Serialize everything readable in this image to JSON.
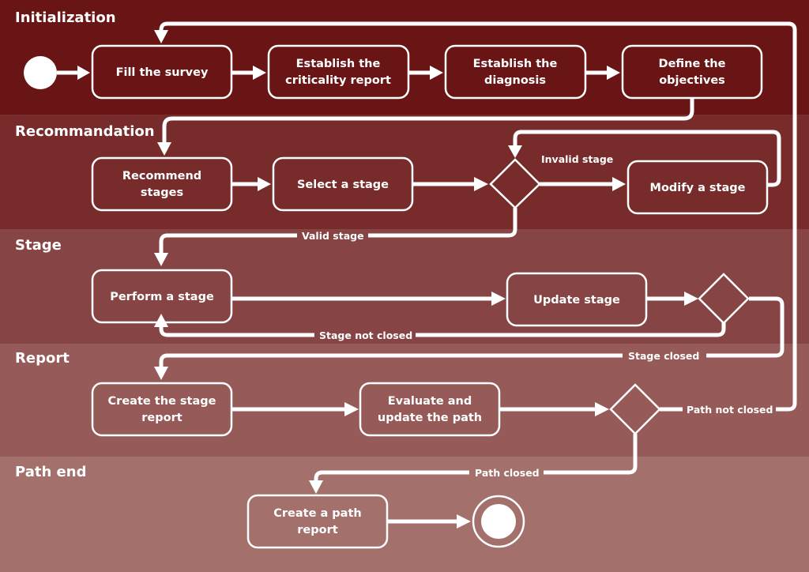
{
  "diagram": {
    "type": "uml-activity-swimlane",
    "lanes": [
      {
        "id": "initialization",
        "label": "Initialization",
        "color": "#6a1515"
      },
      {
        "id": "recommandation",
        "label": "Recommandation",
        "color": "#772b2a"
      },
      {
        "id": "stage",
        "label": "Stage",
        "color": "#864444"
      },
      {
        "id": "report",
        "label": "Report",
        "color": "#965a58"
      },
      {
        "id": "path_end",
        "label": "Path end",
        "color": "#a3706c"
      }
    ],
    "nodes": {
      "start": {
        "kind": "initial"
      },
      "fill_survey": {
        "kind": "action",
        "lines": [
          "Fill the survey"
        ]
      },
      "criticality_report": {
        "kind": "action",
        "lines": [
          "Establish the",
          "criticality report"
        ]
      },
      "diagnosis": {
        "kind": "action",
        "lines": [
          "Establish the",
          "diagnosis"
        ]
      },
      "objectives": {
        "kind": "action",
        "lines": [
          "Define the",
          "objectives"
        ]
      },
      "recommend_stages": {
        "kind": "action",
        "lines": [
          "Recommend",
          "stages"
        ]
      },
      "select_stage": {
        "kind": "action",
        "lines": [
          "Select a stage"
        ]
      },
      "stage_decision": {
        "kind": "decision"
      },
      "modify_stage": {
        "kind": "action",
        "lines": [
          "Modify a stage"
        ]
      },
      "perform_stage": {
        "kind": "action",
        "lines": [
          "Perform a stage"
        ]
      },
      "update_stage": {
        "kind": "action",
        "lines": [
          "Update stage"
        ]
      },
      "closed_decision": {
        "kind": "decision"
      },
      "stage_report": {
        "kind": "action",
        "lines": [
          "Create the stage",
          "report"
        ]
      },
      "evaluate_path": {
        "kind": "action",
        "lines": [
          "Evaluate and",
          "update the path"
        ]
      },
      "path_decision": {
        "kind": "decision"
      },
      "path_report": {
        "kind": "action",
        "lines": [
          "Create a path",
          "report"
        ]
      },
      "end": {
        "kind": "final"
      }
    },
    "edges": [
      {
        "from": "start",
        "to": "fill_survey",
        "label": ""
      },
      {
        "from": "fill_survey",
        "to": "criticality_report",
        "label": ""
      },
      {
        "from": "criticality_report",
        "to": "diagnosis",
        "label": ""
      },
      {
        "from": "diagnosis",
        "to": "objectives",
        "label": ""
      },
      {
        "from": "objectives",
        "to": "recommend_stages",
        "label": ""
      },
      {
        "from": "recommend_stages",
        "to": "select_stage",
        "label": ""
      },
      {
        "from": "select_stage",
        "to": "stage_decision",
        "label": ""
      },
      {
        "from": "stage_decision",
        "to": "modify_stage",
        "label": "Invalid stage"
      },
      {
        "from": "modify_stage",
        "to": "stage_decision",
        "label": ""
      },
      {
        "from": "stage_decision",
        "to": "perform_stage",
        "label": "Valid stage"
      },
      {
        "from": "perform_stage",
        "to": "update_stage",
        "label": ""
      },
      {
        "from": "update_stage",
        "to": "closed_decision",
        "label": ""
      },
      {
        "from": "closed_decision",
        "to": "perform_stage",
        "label": "Stage not closed"
      },
      {
        "from": "closed_decision",
        "to": "stage_report",
        "label": "Stage closed"
      },
      {
        "from": "stage_report",
        "to": "evaluate_path",
        "label": ""
      },
      {
        "from": "evaluate_path",
        "to": "path_decision",
        "label": ""
      },
      {
        "from": "path_decision",
        "to": "fill_survey",
        "label": "Path not closed"
      },
      {
        "from": "path_decision",
        "to": "path_report",
        "label": "Path closed"
      },
      {
        "from": "path_report",
        "to": "end",
        "label": ""
      }
    ]
  }
}
